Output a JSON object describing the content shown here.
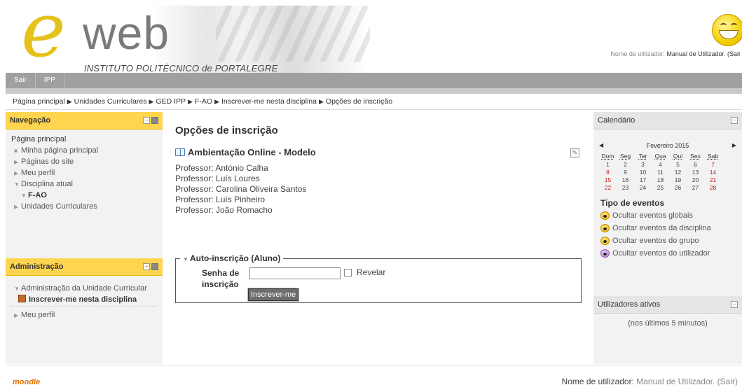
{
  "header": {
    "logo_letter": "e",
    "logo_word": "web",
    "institution": "INSTITUTO POLITÉCNICO de PORTALEGRE",
    "user_prefix": "Nome de utilizador: ",
    "user_name": "Manual de Utilizador",
    "user_logout": "(Sair"
  },
  "topnav": {
    "items": [
      "Sair",
      "IPP"
    ]
  },
  "breadcrumb": [
    "Página principal",
    "Unidades Curriculares",
    "GED IPP",
    "F-AO",
    "Inscrever-me nesta disciplina",
    "Opções de inscrição"
  ],
  "navigation": {
    "title": "Navegação",
    "home": "Página principal",
    "my_home": "Minha página principal",
    "site_pages": "Páginas do site",
    "my_profile": "Meu perfil",
    "current_course": "Disciplina atual",
    "course_code": "F-AO",
    "units": "Unidades Curriculares"
  },
  "administration": {
    "title": "Administração",
    "course_admin": "Administração da Unidade Curricular",
    "enrol_me": "Inscrever-me nesta disciplina",
    "my_profile": "Meu perfil"
  },
  "main": {
    "page_title": "Opções de inscrição",
    "course_title": "Ambientação Online - Modelo",
    "teachers": [
      "Professor: António Calha",
      "Professor: Luís Loures",
      "Professor: Carolina Oliveira Santos",
      "Professor: Luís Pinheiro",
      "Professor: João Romacho"
    ],
    "self_enrol_legend": "Auto-inscrição (Aluno)",
    "password_label": "Senha de inscrição",
    "password_value": "",
    "reveal_label": "Revelar",
    "enrol_button": "Inscrever-me"
  },
  "calendar": {
    "title": "Calendário",
    "month": "Fevereiro 2015",
    "weekdays": [
      "Dom",
      "Seg",
      "Ter",
      "Qua",
      "Qui",
      "Sex",
      "Sab"
    ],
    "weeks": [
      [
        "1",
        "2",
        "3",
        "4",
        "5",
        "6",
        "7"
      ],
      [
        "8",
        "9",
        "10",
        "11",
        "12",
        "13",
        "14"
      ],
      [
        "15",
        "16",
        "17",
        "18",
        "19",
        "20",
        "21"
      ],
      [
        "22",
        "23",
        "24",
        "25",
        "26",
        "27",
        "28"
      ]
    ],
    "events_title": "Tipo de eventos",
    "events": [
      "Ocultar eventos globais",
      "Ocultar eventos da disciplina",
      "Ocultar eventos do grupo",
      "Ocultar eventos do utilizador"
    ]
  },
  "active_users": {
    "title": "Utilizadores ativos",
    "note": "(nos últimos 5 minutos)"
  },
  "footer": {
    "moodle": "moodle",
    "user_prefix": "Nome de utilizador: ",
    "user_name": "Manual de Utilizador.",
    "logout": "(Sair)"
  }
}
